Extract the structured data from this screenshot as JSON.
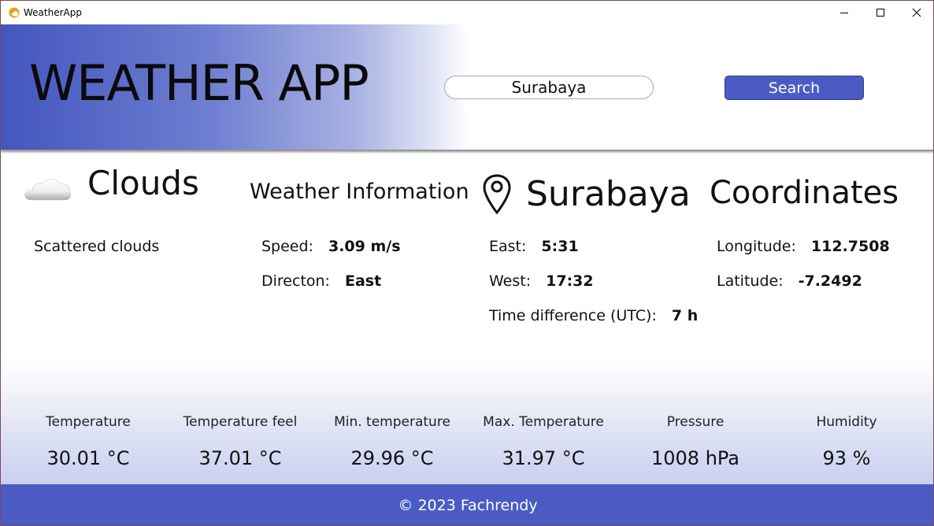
{
  "window": {
    "title": "WeatherApp",
    "icons": [
      "app-icon",
      "minimize-icon",
      "maximize-icon",
      "close-icon"
    ]
  },
  "header": {
    "app_title": "WEATHER APP",
    "search_value": "Surabaya",
    "search_button_label": "Search"
  },
  "weather": {
    "main": "Clouds",
    "description": "Scattered clouds",
    "icon": "cloud-icon"
  },
  "wind": {
    "heading": "Weather Information",
    "speed_label": "Speed:",
    "speed_value": "3.09 m/s",
    "direction_label": "Directon:",
    "direction_value": "East"
  },
  "location": {
    "city": "Surabaya",
    "icon": "location-pin-icon",
    "east_label": "East:",
    "east_value": "5:31",
    "west_label": "West:",
    "west_value": "17:32",
    "timediff_label": "Time difference (UTC):",
    "timediff_value": "7 h"
  },
  "coordinates": {
    "heading": "Coordinates",
    "longitude_label": "Longitude:",
    "longitude_value": "112.7508",
    "latitude_label": "Latitude:",
    "latitude_value": "-7.2492"
  },
  "stats": [
    {
      "label": "Temperature",
      "value": "30.01 °C"
    },
    {
      "label": "Temperature feel",
      "value": "37.01 °C"
    },
    {
      "label": "Min. temperature",
      "value": "29.96 °C"
    },
    {
      "label": "Max. Temperature",
      "value": "31.97 °C"
    },
    {
      "label": "Pressure",
      "value": "1008 hPa"
    },
    {
      "label": "Humidity",
      "value": "93 %"
    }
  ],
  "footer": {
    "text": "© 2023 Fachrendy"
  },
  "colors": {
    "accent": "#4a5cc3",
    "header_gradient_start": "#4356be",
    "footer": "#4a5cc3"
  }
}
